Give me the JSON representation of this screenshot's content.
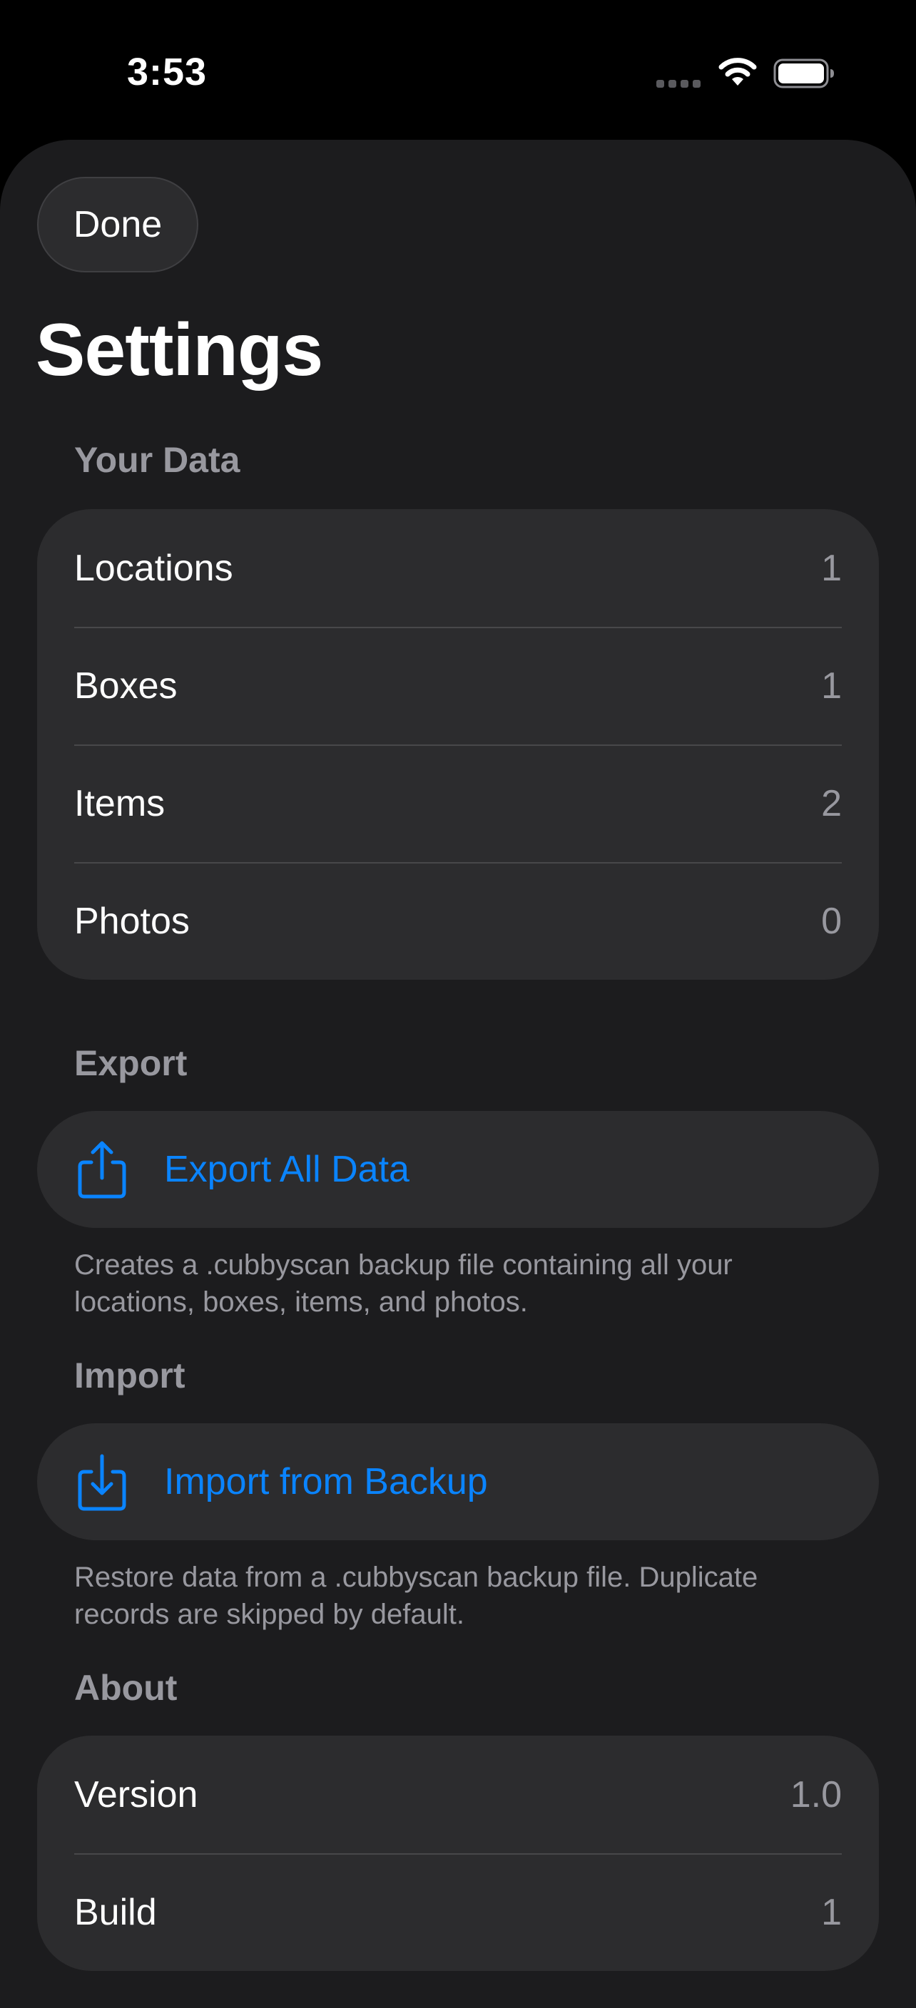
{
  "status_bar": {
    "time": "3:53",
    "icons": [
      "cellular-dots-icon",
      "wifi-icon",
      "battery-icon"
    ]
  },
  "header": {
    "done_label": "Done",
    "title": "Settings"
  },
  "your_data": {
    "header": "Your Data",
    "rows": [
      {
        "label": "Locations",
        "value": "1"
      },
      {
        "label": "Boxes",
        "value": "1"
      },
      {
        "label": "Items",
        "value": "2"
      },
      {
        "label": "Photos",
        "value": "0"
      }
    ]
  },
  "export": {
    "header": "Export",
    "action_label": "Export All Data",
    "icon": "share-upload-icon",
    "footnote": "Creates a .cubbyscan backup file containing all your locations, boxes, items, and photos."
  },
  "import": {
    "header": "Import",
    "action_label": "Import from Backup",
    "icon": "download-tray-icon",
    "footnote": "Restore data from a .cubbyscan backup file. Duplicate records are skipped by default."
  },
  "about": {
    "header": "About",
    "rows": [
      {
        "label": "Version",
        "value": "1.0"
      },
      {
        "label": "Build",
        "value": "1"
      }
    ]
  },
  "colors": {
    "background": "#000000",
    "sheet": "#1c1c1e",
    "group": "#2c2c2e",
    "accent": "#0a84ff",
    "secondary_text": "#98989f"
  }
}
